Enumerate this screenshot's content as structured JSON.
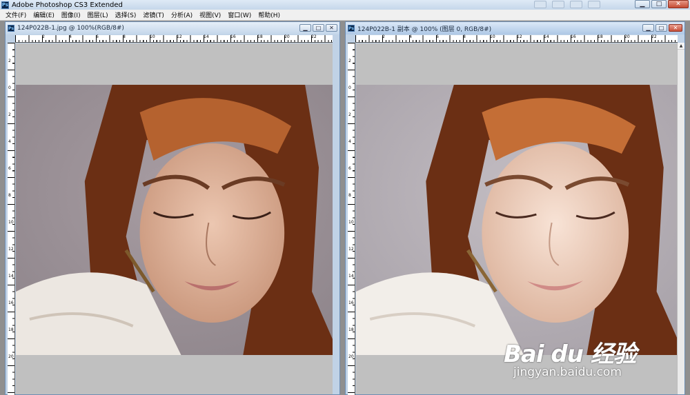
{
  "app": {
    "title": "Adobe Photoshop CS3 Extended",
    "logo_text": "Ps",
    "window_buttons": [
      "▁",
      "□",
      "✕"
    ]
  },
  "menu": [
    "文件(F)",
    "编辑(E)",
    "图像(I)",
    "图层(L)",
    "选择(S)",
    "滤镜(T)",
    "分析(A)",
    "视图(V)",
    "窗口(W)",
    "帮助(H)"
  ],
  "documents": [
    {
      "title": "124P022B-1.jpg @ 100%(RGB/8#)",
      "buttons": [
        "▁",
        "□",
        "✕"
      ]
    },
    {
      "title": "124P022B-1 副本 @ 100% (图层 0, RGB/8#)",
      "buttons": [
        "▁",
        "□",
        "✕"
      ]
    }
  ],
  "ruler_h_labels": [
    "2",
    "4",
    "6",
    "8",
    "10",
    "12",
    "14",
    "16",
    "18",
    "20",
    "22",
    "24"
  ],
  "ruler_v_labels": [
    "2",
    "0",
    "2",
    "4",
    "6",
    "8",
    "10",
    "12",
    "14",
    "16",
    "18",
    "20"
  ],
  "scroll_arrow_up": "▲",
  "watermark": {
    "logo": "Bai du 经验",
    "url": "jingyan.baidu.com"
  },
  "colors": {
    "background_canvas": "#c0c0c0",
    "hair": "#7a3b1a",
    "skin_original": "#e8c2a8",
    "skin_softened": "#f3d9c9"
  }
}
